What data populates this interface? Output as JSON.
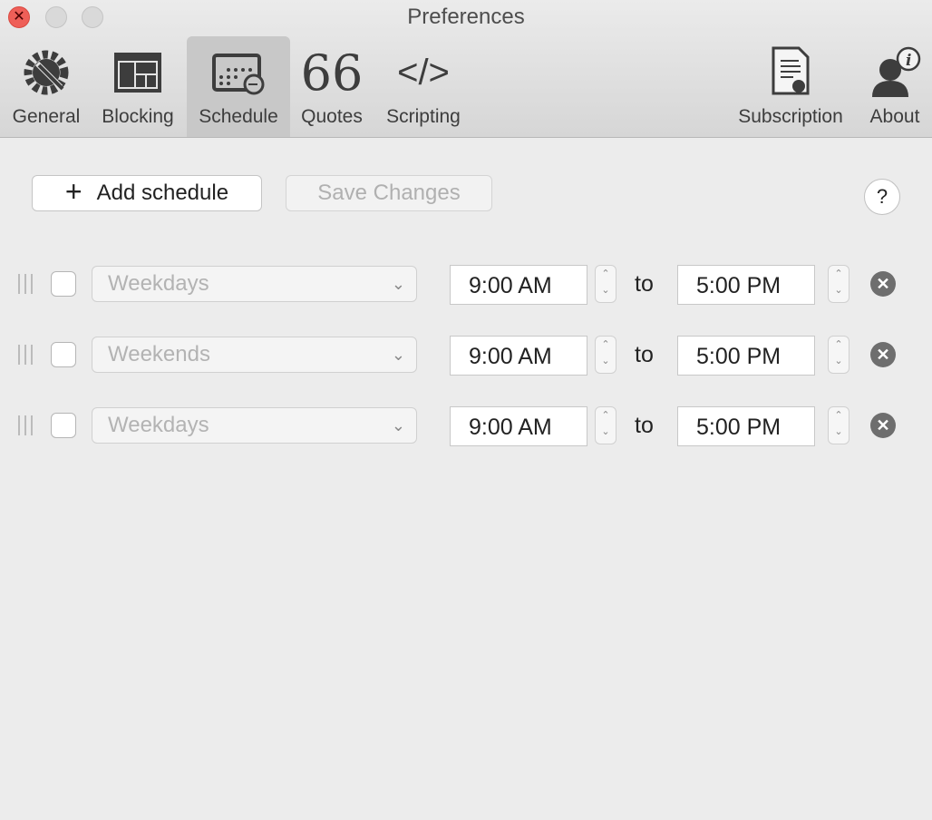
{
  "window": {
    "title": "Preferences"
  },
  "toolbar": [
    {
      "label": "General",
      "icon": "gear-wrench-icon"
    },
    {
      "label": "Blocking",
      "icon": "window-layout-icon"
    },
    {
      "label": "Schedule",
      "icon": "calendar-clock-icon",
      "selected": true
    },
    {
      "label": "Quotes",
      "icon": "quote-icon"
    },
    {
      "label": "Scripting",
      "icon": "code-icon"
    },
    {
      "label": "Subscription",
      "icon": "certificate-icon"
    },
    {
      "label": "About",
      "icon": "person-info-icon"
    }
  ],
  "actions": {
    "add_label": "Add schedule",
    "add_icon": "+",
    "save_label": "Save Changes",
    "help_label": "?"
  },
  "schedules": [
    {
      "days": "Weekdays",
      "start": "9:00 AM",
      "sep": "to",
      "end": "5:00 PM",
      "enabled": false
    },
    {
      "days": "Weekends",
      "start": "9:00 AM",
      "sep": "to",
      "end": "5:00 PM",
      "enabled": false
    },
    {
      "days": "Weekdays",
      "start": "9:00 AM",
      "sep": "to",
      "end": "5:00 PM",
      "enabled": false
    }
  ]
}
